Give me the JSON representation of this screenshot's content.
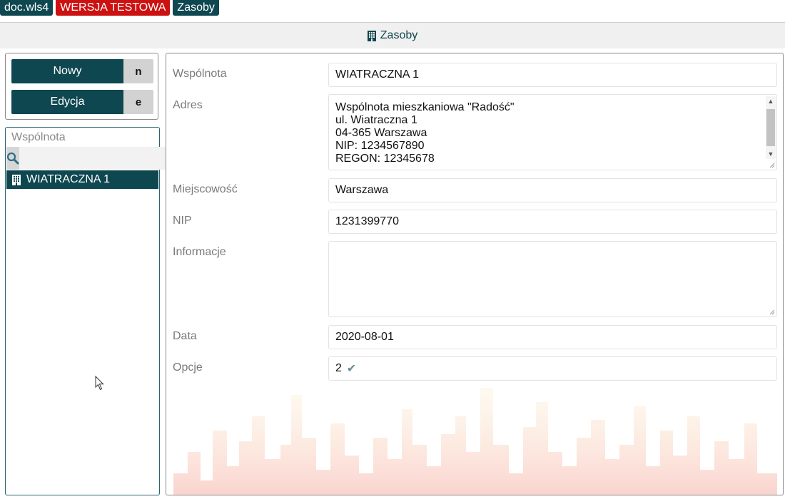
{
  "top_tags": {
    "app": "doc.wls4",
    "test_version": "WERSJA TESTOWA",
    "resources": "Zasoby"
  },
  "header": {
    "title": "Zasoby",
    "icon": "building-icon"
  },
  "actions": {
    "new_label": "Nowy",
    "new_key": "n",
    "edit_label": "Edycja",
    "edit_key": "e"
  },
  "list": {
    "title": "Wspólnota",
    "search_placeholder": "",
    "search_suffix": "/",
    "items": [
      {
        "label": "WIATRACZNA 1",
        "icon": "building-icon"
      }
    ]
  },
  "form": {
    "wspolnota": {
      "label": "Wspólnota",
      "value": "WIATRACZNA 1"
    },
    "adres": {
      "label": "Adres",
      "value": "Wspólnota mieszkaniowa \"Radość\"\nul. Wiatraczna 1\n04-365 Warszawa\nNIP: 1234567890\nREGON: 12345678"
    },
    "miejscowosc": {
      "label": "Miejscowość",
      "value": "Warszawa"
    },
    "nip": {
      "label": "NIP",
      "value": "1231399770"
    },
    "informacje": {
      "label": "Informacje",
      "value": ""
    },
    "data": {
      "label": "Data",
      "value": "2020-08-01"
    },
    "opcje": {
      "label": "Opcje",
      "value": "2"
    }
  },
  "colors": {
    "primary": "#0e4750",
    "test_badge": "#cc1111",
    "key_bg": "#d2d2d2"
  }
}
